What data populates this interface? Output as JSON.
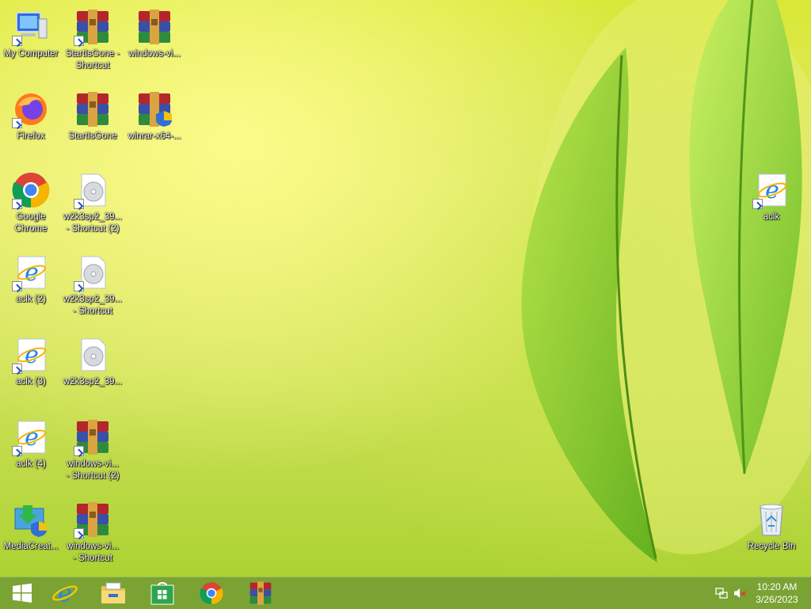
{
  "desktop": {
    "icons": {
      "my_computer": "My Computer",
      "firefox": "Firefox",
      "chrome": "Google\nChrome",
      "aclk2": "aclk (2)",
      "aclk3": "aclk (3)",
      "aclk4": "aclk (4)",
      "mediacreation": "MediaCreat...",
      "startisgone_shortcut": "StartIsGone -\nShortcut",
      "startisgone": "StartIsGone",
      "w2k3_shortcut2": "w2k3sp2_39...\n- Shortcut (2)",
      "w2k3_shortcut": "w2k3sp2_39...\n- Shortcut",
      "w2k3": "w2k3sp2_39...",
      "windows_vi_shortcut2": "windows-vi...\n- Shortcut (2)",
      "windows_vi_shortcut": "windows-vi...\n- Shortcut",
      "windows_vi": "windows-vi...",
      "winrar_x64": "winrar-x64-...",
      "aclk": "aclk",
      "recycle_bin": "Recycle Bin"
    }
  },
  "taskbar": {
    "pinned": [
      "start-icon",
      "internet-explorer-icon",
      "file-explorer-icon",
      "store-icon",
      "chrome-icon",
      "winrar-icon"
    ],
    "clock": {
      "time": "10:20 AM",
      "date": "3/26/2023"
    },
    "tray_icons": [
      "network-icon",
      "volume-muted-icon"
    ]
  },
  "colors": {
    "taskbar": "#769e34",
    "ie_blue": "#1e88e5",
    "winrar_red": "#b3262b"
  }
}
